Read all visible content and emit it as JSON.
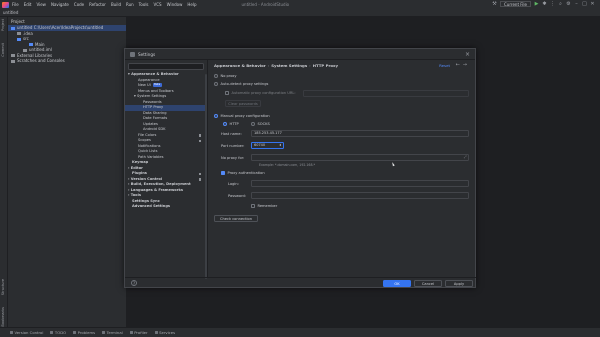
{
  "menubar": {
    "items": [
      "File",
      "Edit",
      "View",
      "Navigate",
      "Code",
      "Refactor",
      "Build",
      "Run",
      "Tools",
      "VCS",
      "Window",
      "Help"
    ],
    "project_title": "untitled - AndroidStudio",
    "run_config": "Current File"
  },
  "breadcrumb": "untitled",
  "left_strip": [
    "Project",
    "Commit"
  ],
  "left_strip_bottom": [
    "Structure",
    "Bookmarks"
  ],
  "project_panel": {
    "header": "Project",
    "tree": [
      {
        "label": "untitled  C:\\Users\\Acer\\IdeaProjects\\untitled",
        "indent": 0,
        "selected": true
      },
      {
        "label": ".idea",
        "indent": 1
      },
      {
        "label": "src",
        "indent": 1
      },
      {
        "label": "Main",
        "indent": 3
      },
      {
        "label": "untitled.iml",
        "indent": 2
      },
      {
        "label": "External Libraries",
        "indent": 0
      },
      {
        "label": "Scratches and Consoles",
        "indent": 0
      }
    ]
  },
  "status_bar": [
    "Version Control",
    "TODO",
    "Problems",
    "Terminal",
    "Profiler",
    "Services"
  ],
  "dialog": {
    "title": "Settings",
    "nav": [
      {
        "label": "Appearance & Behavior",
        "indent": 0,
        "bold": true
      },
      {
        "label": "Appearance",
        "indent": 2
      },
      {
        "label": "New UI",
        "indent": 2,
        "tag": "Beta"
      },
      {
        "label": "Menus and Toolbars",
        "indent": 2
      },
      {
        "label": "System Settings",
        "indent": 2
      },
      {
        "label": "Passwords",
        "indent": 4
      },
      {
        "label": "HTTP Proxy",
        "indent": 4,
        "selected": true
      },
      {
        "label": "Data Sharing",
        "indent": 4
      },
      {
        "label": "Date Formats",
        "indent": 4
      },
      {
        "label": "Updates",
        "indent": 4
      },
      {
        "label": "Android SDK",
        "indent": 4
      },
      {
        "label": "File Colors",
        "indent": 2,
        "sq": true
      },
      {
        "label": "Scopes",
        "indent": 2,
        "sq": true
      },
      {
        "label": "Notifications",
        "indent": 2
      },
      {
        "label": "Quick Lists",
        "indent": 2
      },
      {
        "label": "Path Variables",
        "indent": 2
      },
      {
        "label": "Keymap",
        "indent": 0,
        "bold": true
      },
      {
        "label": "Editor",
        "indent": 0,
        "bold": true
      },
      {
        "label": "Plugins",
        "indent": 0,
        "bold": true,
        "sq": true
      },
      {
        "label": "Version Control",
        "indent": 0,
        "bold": true,
        "sq": true
      },
      {
        "label": "Build, Execution, Deployment",
        "indent": 0,
        "bold": true
      },
      {
        "label": "Languages & Frameworks",
        "indent": 0,
        "bold": true
      },
      {
        "label": "Tools",
        "indent": 0,
        "bold": true
      },
      {
        "label": "Settings Sync",
        "indent": 0,
        "bold": true
      },
      {
        "label": "Advanced Settings",
        "indent": 0,
        "bold": true
      }
    ],
    "breadcrumb": [
      "Appearance & Behavior",
      "System Settings",
      "HTTP Proxy"
    ],
    "reset_label": "Reset",
    "no_proxy_label": "No proxy",
    "auto_detect_label": "Auto-detect proxy settings",
    "auto_config_label": "Automatic proxy configuration URL:",
    "clear_passwords_label": "Clear passwords",
    "manual_label": "Manual proxy configuration",
    "http_label": "HTTP",
    "socks_label": "SOCKS",
    "host_label": "Host name:",
    "host_value": "185.253.45.177",
    "port_label": "Port number:",
    "port_value": "60740",
    "no_proxy_for_label": "No proxy for:",
    "example_hint": "Example: *.domain.com, 192.168.*",
    "auth_label": "Proxy authentication",
    "login_label": "Login:",
    "password_label": "Password:",
    "remember_label": "Remember",
    "check_connection_label": "Check connection",
    "ok_label": "OK",
    "cancel_label": "Cancel",
    "apply_label": "Apply"
  },
  "colors": {
    "accent": "#3574f0",
    "selection": "#2e436e",
    "link": "#548af7"
  }
}
